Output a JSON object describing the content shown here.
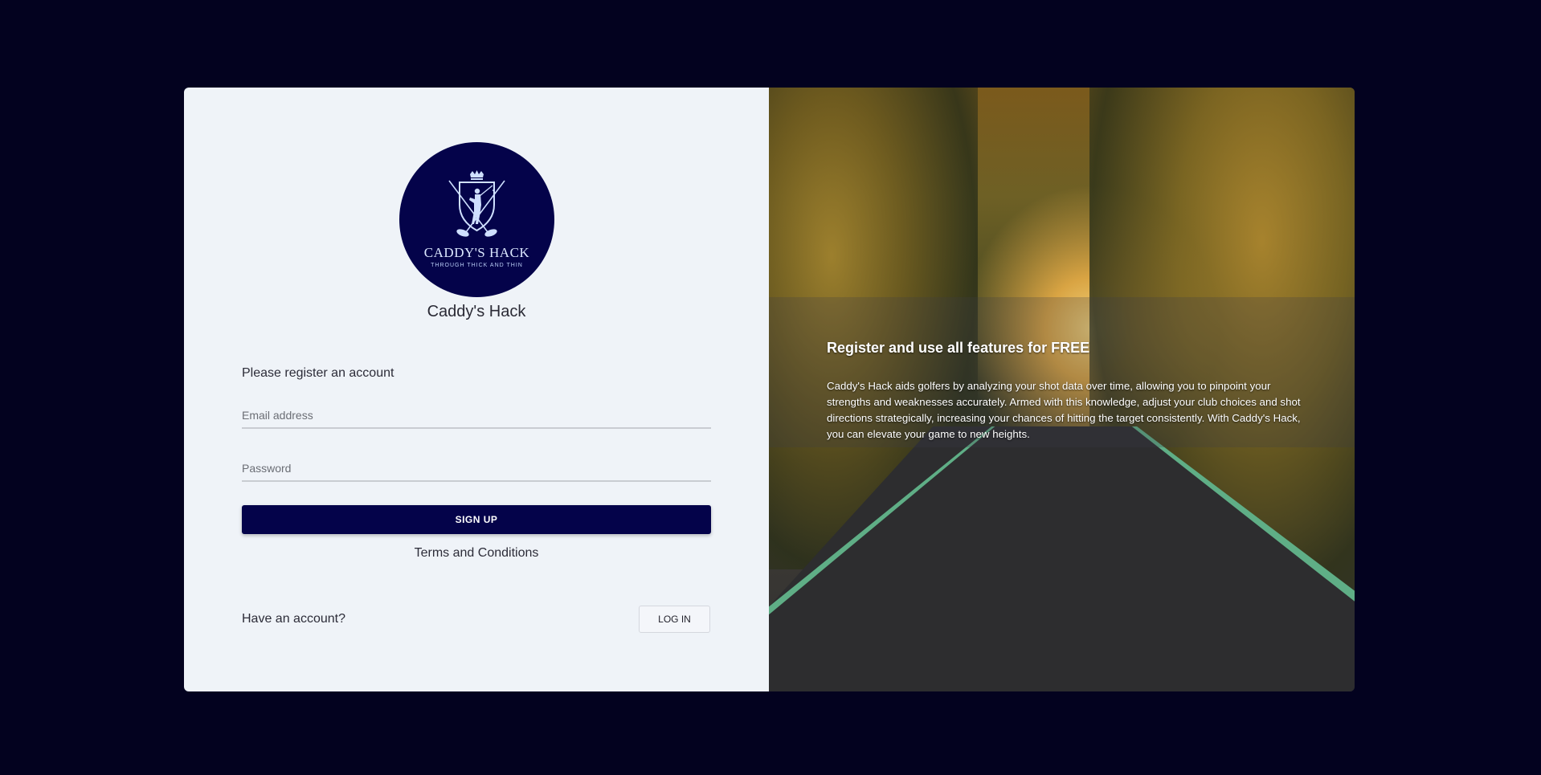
{
  "logo": {
    "name": "CADDY'S HACK",
    "tagline": "THROUGH THICK AND THIN",
    "icon": "golfer-crest-icon"
  },
  "app_name": "Caddy's Hack",
  "form": {
    "prompt": "Please register an account",
    "email_placeholder": "Email address",
    "password_placeholder": "Password",
    "signup_label": "SIGN UP",
    "terms_label": "Terms and Conditions",
    "have_account": "Have an account?",
    "login_label": "LOG IN"
  },
  "promo": {
    "title": "Register and use all features for FREE",
    "text": "Caddy's Hack aids golfers by analyzing your shot data over time, allowing you to pinpoint your strengths and weaknesses accurately. Armed with this knowledge, adjust your club choices and shot directions strategically, increasing your chances of hitting the target consistently. With Caddy's Hack, you can elevate your game to new heights."
  },
  "colors": {
    "page_background": "#03021f",
    "brand_navy": "#04034a",
    "panel_background": "#eff3f8"
  }
}
